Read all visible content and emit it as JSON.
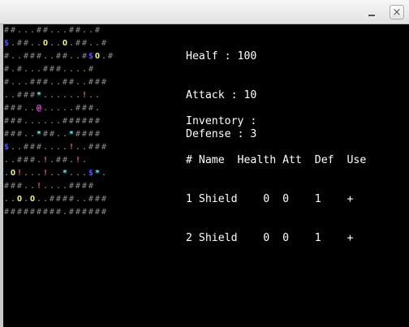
{
  "window": {
    "close_glyph": "×",
    "minimize_icon": "minimize-icon",
    "close_icon": "close-icon"
  },
  "colors": {
    "wall": "#8a8a8a",
    "floor": "#a8a8a8",
    "gold": "#ffff55",
    "blue": "#5555ff",
    "cyan": "#55ffff",
    "red": "#ff5555",
    "player": "#ff55ff"
  },
  "map_rows": [
    "##...##...##..#",
    "$.##..O..O.##..#",
    "#..###..##..#$O.#",
    "#.#...###....#",
    "#...###..##..###",
    "..###*......!..",
    "###..@.....###.",
    "###......######",
    "###..*##..*####",
    "$..###....!..###",
    "..###.!.##.!.",
    ".O!...!..*...$*.",
    "###..!....####",
    "..O.O..####..###",
    "#########.######"
  ],
  "stats": {
    "health": "Healf : 100",
    "attack": "Attack : 10",
    "defense": "Defense : 3"
  },
  "inventory": {
    "title": "Inventory :",
    "header": "# Name  Health Att  Def  Use",
    "items": [
      "1 Shield    0  0    1    +",
      "2 Shield    0  0    1    +"
    ]
  }
}
